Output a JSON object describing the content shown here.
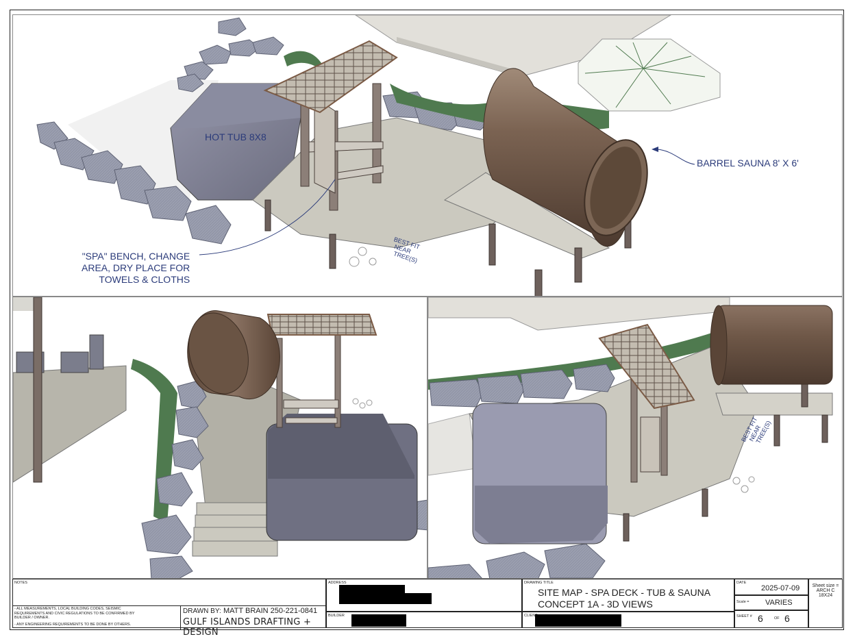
{
  "views": {
    "top": {
      "hot_tub_label": "HOT TUB 8X8",
      "sauna_label": "BARREL SAUNA 8' X 6'",
      "bench_label_lines": [
        "\"SPA\" BENCH, CHANGE",
        "AREA, DRY PLACE FOR",
        "TOWELS & CLOTHS"
      ],
      "fit_note_lines": [
        "BEST FIT",
        "NEAR",
        "TREE(S)"
      ]
    },
    "right": {
      "fit_note_lines": [
        "BEST FIT",
        "NEAR",
        "TREE(S)"
      ]
    }
  },
  "title_block": {
    "notes_header": "NOTES",
    "notes_lines": [
      "- ALL MEASUREMENTS, LOCAL BUILDING CODES, SEISMIC",
      "REQUIREMENTS AND CIVIC REGULATIONS TO BE CONFIRMED BY",
      "BUILDER / OWNER.",
      "- ANY ENGINEERING REQUIREMENTS TO BE DONE BY OTHERS."
    ],
    "drawn_by_label": "DRAWN BY:",
    "drawn_by": "MATT BRAIN  250-221-0841",
    "company": "GULF ISLANDS DRAFTING + DESIGN",
    "address_label": "ADDRESS",
    "builder_label": "BUILDER",
    "drawing_title_label": "DRAWING TITLE",
    "drawing_title_line1": "SITE MAP - SPA DECK - TUB & SAUNA",
    "drawing_title_line2": "CONCEPT 1A - 3D VIEWS",
    "client_label": "CLIENT",
    "date_label": "DATE",
    "date": "2025-07-09",
    "scale_label": "Scale =",
    "scale": "VARIES",
    "sheet_label": "SHEET #",
    "sheet_number": "6",
    "of_label": "OF",
    "sheet_total": "6",
    "sheet_size_lines": [
      "Sheet size =",
      "ARCH C",
      "18X24"
    ]
  },
  "colors": {
    "annotation": "#2b3b7a",
    "stone": "#8f94a6",
    "deck": "#c9c7bc",
    "post": "#6e615c",
    "sauna": "#6e5747",
    "tub": "#6f7082",
    "hedge": "#4f7a4f"
  }
}
